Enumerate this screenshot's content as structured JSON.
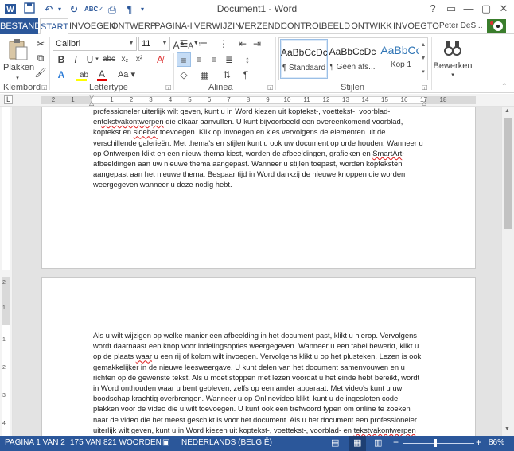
{
  "title": "Document1 - Word",
  "window_controls": {
    "help": "?",
    "ribbon_opts": "▭",
    "minimize": "—",
    "restore": "▢",
    "close": "✕"
  },
  "tabs": [
    {
      "label": "BESTAND"
    },
    {
      "label": "START"
    },
    {
      "label": "INVOEGEN"
    },
    {
      "label": "ONTWERP"
    },
    {
      "label": "PAGINA-I"
    },
    {
      "label": "VERWIJZIN"
    },
    {
      "label": "VERZENDI"
    },
    {
      "label": "CONTROL"
    },
    {
      "label": "BEELD"
    },
    {
      "label": "ONTWIKK"
    },
    {
      "label": "INVOEGTO"
    }
  ],
  "user": "Peter DeS...",
  "ribbon": {
    "clipboard": {
      "paste_label": "Plakken",
      "group_label": "Klembord"
    },
    "font": {
      "name": "Calibri",
      "size": "11",
      "group_label": "Lettertype",
      "grow": "A",
      "shrink": "A",
      "case": "Aa"
    },
    "paragraph": {
      "group_label": "Alinea"
    },
    "styles": {
      "group_label": "Stijlen",
      "items": [
        {
          "preview": "AaBbCcDc",
          "name": "¶ Standaard"
        },
        {
          "preview": "AaBbCcDc",
          "name": "¶ Geen afs..."
        },
        {
          "preview": "AaBbCc",
          "name": "Kop 1"
        }
      ]
    },
    "editing": {
      "label": "Bewerken"
    }
  },
  "ruler_numbers": [
    "2",
    "1",
    "1",
    "2",
    "3",
    "4",
    "5",
    "6",
    "7",
    "8",
    "9",
    "10",
    "11",
    "12",
    "13",
    "14",
    "15",
    "16",
    "17",
    "18"
  ],
  "page1_paragraph": [
    {
      "t": "professioneler uiterlijk wilt geven, kunt u in Word kiezen uit koptekst-, voettekst-, voorblad- en"
    },
    {
      "t": "tekstvakontwerpen",
      "sq": true
    },
    {
      "t": " die elkaar aanvullen. U kunt bijvoorbeeld een overeenkomend voorblad, koptekst en "
    },
    {
      "t": "sidebar",
      "sq": true
    },
    {
      "t": " toevoegen. Klik op Invoegen en kies vervolgens de elementen uit de verschillende galerieën. Met thema's en stijlen kunt u ook uw document op orde houden. Wanneer u op Ontwerpen klikt en een nieuw thema kiest, worden de afbeeldingen, grafieken en "
    },
    {
      "t": "SmartArt",
      "sq": true
    },
    {
      "t": "-afbeeldingen aan uw nieuwe thema aangepast. Wanneer u stijlen toepast, worden kopteksten aangepast aan het nieuwe thema. Bespaar tijd in Word dankzij de nieuwe knoppen die worden weergegeven wanneer u deze nodig hebt."
    }
  ],
  "page2_paragraph": [
    {
      "t": "Als u wilt wijzigen op welke manier een afbeelding in het document past, klikt u hierop. Vervolgens wordt daarnaast een knop voor indelingsopties weergegeven. Wanneer u een tabel bewerkt, klikt u op de plaats "
    },
    {
      "t": "waar",
      "sq": true
    },
    {
      "t": " u een rij of kolom wilt invoegen. Vervolgens klikt u op het plusteken. Lezen is ook gemakkelijker in de nieuwe leesweergave. U kunt delen van het document samenvouwen en u richten op de gewenste tekst. Als u moet stoppen met lezen voordat u het einde hebt bereikt, wordt in Word onthouden waar u bent gebleven, zelfs op een ander apparaat. Met video's kunt u uw boodschap krachtig overbrengen. Wanneer u op Onlinevideo klikt, kunt u de ingesloten code plakken voor de video die u wilt toevoegen. U kunt ook een trefwoord typen om online te zoeken naar de video die het meest geschikt is voor het document. Als u het document een professioneler uiterlijk wilt geven, kunt u in Word kiezen uit koptekst-, voettekst-, voorblad- en "
    },
    {
      "t": "tekstvakontwerpen",
      "sq": true
    },
    {
      "t": " die"
    }
  ],
  "status": {
    "page": "PAGINA 1 VAN 2",
    "words": "175 VAN 821 WOORDEN",
    "language": "NEDERLANDS (BELGIË)",
    "zoom": "86%"
  },
  "colors": {
    "accent": "#2b579a",
    "squiggle": "#e02020",
    "workspace": "#e3e3e3"
  }
}
